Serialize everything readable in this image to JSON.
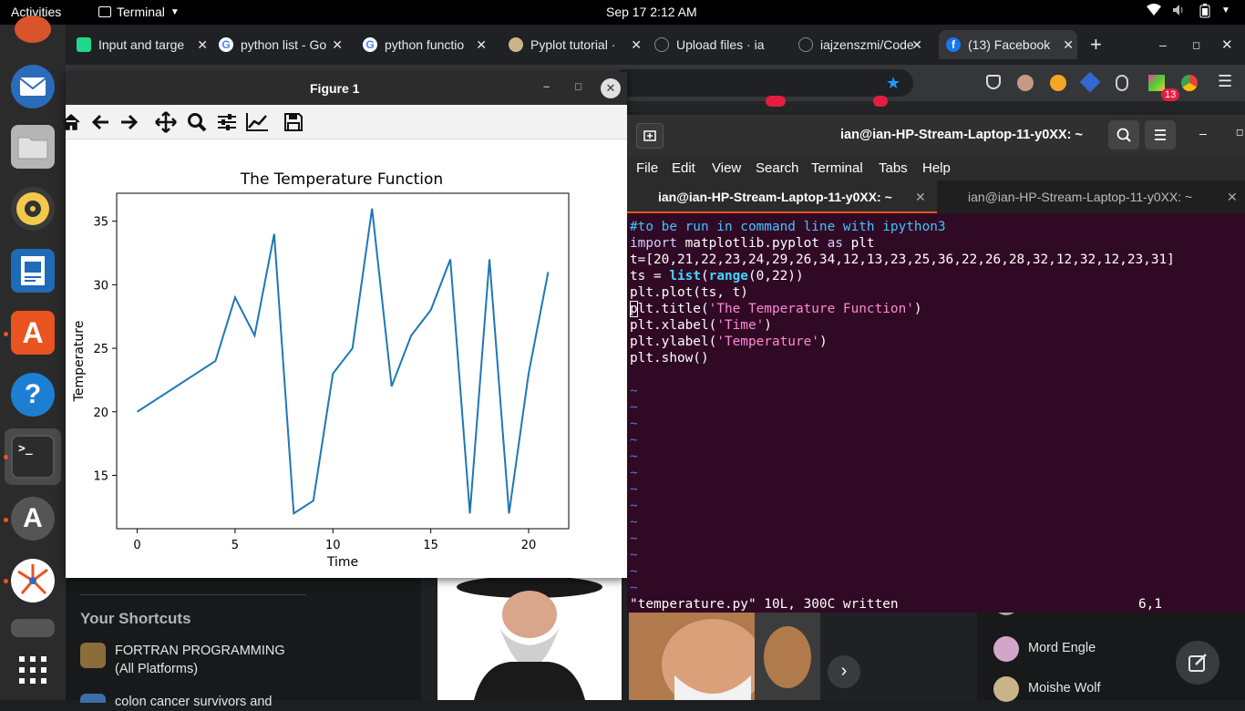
{
  "topbar": {
    "activities": "Activities",
    "app_menu": "Terminal",
    "clock": "Sep 17  2:12 AM"
  },
  "browser": {
    "tabs": [
      {
        "label": "Input and targe",
        "favicon_color": "#21d789"
      },
      {
        "label": "python list - Go",
        "favicon_color": "#ffffff"
      },
      {
        "label": "python functio",
        "favicon_color": "#ffffff"
      },
      {
        "label": "Pyplot tutorial ·",
        "favicon_color": "#c8b68a"
      },
      {
        "label": "Upload files · ia",
        "favicon_color": "#202124"
      },
      {
        "label": "iajzenszmi/Code",
        "favicon_color": "#202124"
      },
      {
        "label": "(13) Facebook",
        "favicon_color": "#1877f2"
      }
    ],
    "new_tab": "+",
    "notification_badge": "13"
  },
  "facebook": {
    "your_shortcuts_heading": "Your Shortcuts",
    "shortcuts": [
      {
        "label": "FORTRAN PROGRAMMING\n(All Platforms)"
      },
      {
        "label": "colon cancer survivors and"
      }
    ],
    "contacts": [
      {
        "name": "Mord Engle"
      },
      {
        "name": "Moishe Wolf"
      }
    ]
  },
  "figure": {
    "window_title": "Figure 1",
    "toolbar": [
      "home-icon",
      "back-icon",
      "forward-icon",
      "pan-icon",
      "zoom-icon",
      "configure-subplots-icon",
      "edit-axis-icon",
      "save-icon"
    ]
  },
  "chart_data": {
    "type": "line",
    "title": "The Temperature Function",
    "xlabel": "Time",
    "ylabel": "Temperature",
    "x": [
      0,
      1,
      2,
      3,
      4,
      5,
      6,
      7,
      8,
      9,
      10,
      11,
      12,
      13,
      14,
      15,
      16,
      17,
      18,
      19,
      20,
      21
    ],
    "series": [
      {
        "values": [
          20,
          21,
          22,
          23,
          24,
          29,
          26,
          34,
          12,
          13,
          23,
          25,
          36,
          22,
          26,
          28,
          32,
          12,
          32,
          12,
          23,
          31
        ],
        "color": "#1f77b4"
      }
    ],
    "xlim": [
      -1.05,
      22.05
    ],
    "ylim": [
      10.8,
      37.2
    ],
    "xticks": [
      "0",
      "5",
      "10",
      "15",
      "20"
    ],
    "yticks": [
      "15",
      "20",
      "25",
      "30",
      "35"
    ],
    "grid": false
  },
  "terminal": {
    "window_title": "ian@ian-HP-Stream-Laptop-11-y0XX: ~",
    "menu": [
      "File",
      "Edit",
      "View",
      "Search",
      "Terminal",
      "Tabs",
      "Help"
    ],
    "tabs": [
      {
        "label": "ian@ian-HP-Stream-Laptop-11-y0XX: ~"
      },
      {
        "label": "ian@ian-HP-Stream-Laptop-11-y0XX: ~"
      }
    ],
    "code": {
      "l1": "#to be run in command line with ipython3",
      "l2_a": "import",
      "l2_b": " matplotlib.pyplot ",
      "l2_c": "as",
      "l2_d": " plt",
      "l3": "t=[20,21,22,23,24,29,26,34,12,13,23,25,36,22,26,28,32,12,32,12,23,31]",
      "l4_a": "ts = ",
      "l4_b": "list",
      "l4_c": "(",
      "l4_d": "range",
      "l4_e": "(0,22))",
      "l5": "plt.plot(ts, t)",
      "l6_a": "plt.title(",
      "l6_b": "'The Temperature Function'",
      "l6_c": ")",
      "l7_a": "plt.xlabel(",
      "l7_b": "'Time'",
      "l7_c": ")",
      "l8_a": "plt.ylabel(",
      "l8_b": "'Temperature'",
      "l8_c": ")",
      "l9": "plt.show()"
    },
    "status_left": "\"temperature.py\" 10L, 300C written",
    "status_right": "6,1"
  }
}
